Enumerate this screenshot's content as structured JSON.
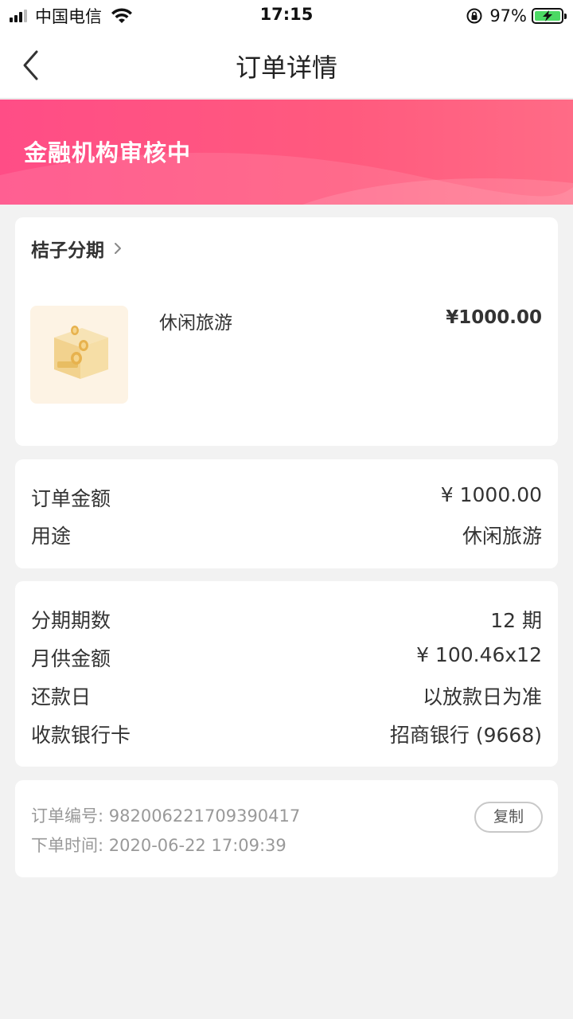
{
  "status_bar": {
    "carrier": "中国电信",
    "time": "17:15",
    "battery_percent": "97%"
  },
  "nav": {
    "title": "订单详情",
    "back_icon": "chevron-left-icon"
  },
  "banner": {
    "status_text": "金融机构审核中",
    "color": "#ff4d86"
  },
  "product": {
    "vendor": "桔子分期",
    "name": "休闲旅游",
    "price": "¥1000.00",
    "thumb_icon": "coin-box-icon"
  },
  "order_amount": {
    "rows": [
      {
        "label": "订单金额",
        "value": "¥ 1000.00"
      },
      {
        "label": "用途",
        "value": "休闲旅游"
      }
    ]
  },
  "plan": {
    "rows": [
      {
        "label": "分期期数",
        "value": "12 期"
      },
      {
        "label": "月供金额",
        "value": "¥ 100.46x12"
      },
      {
        "label": "还款日",
        "value": "以放款日为准"
      },
      {
        "label": "收款银行卡",
        "value": "招商银行 (9668)"
      }
    ]
  },
  "meta": {
    "order_no": "订单编号: 982006221709390417",
    "order_time": "下单时间: 2020-06-22 17:09:39",
    "copy_label": "复制"
  }
}
